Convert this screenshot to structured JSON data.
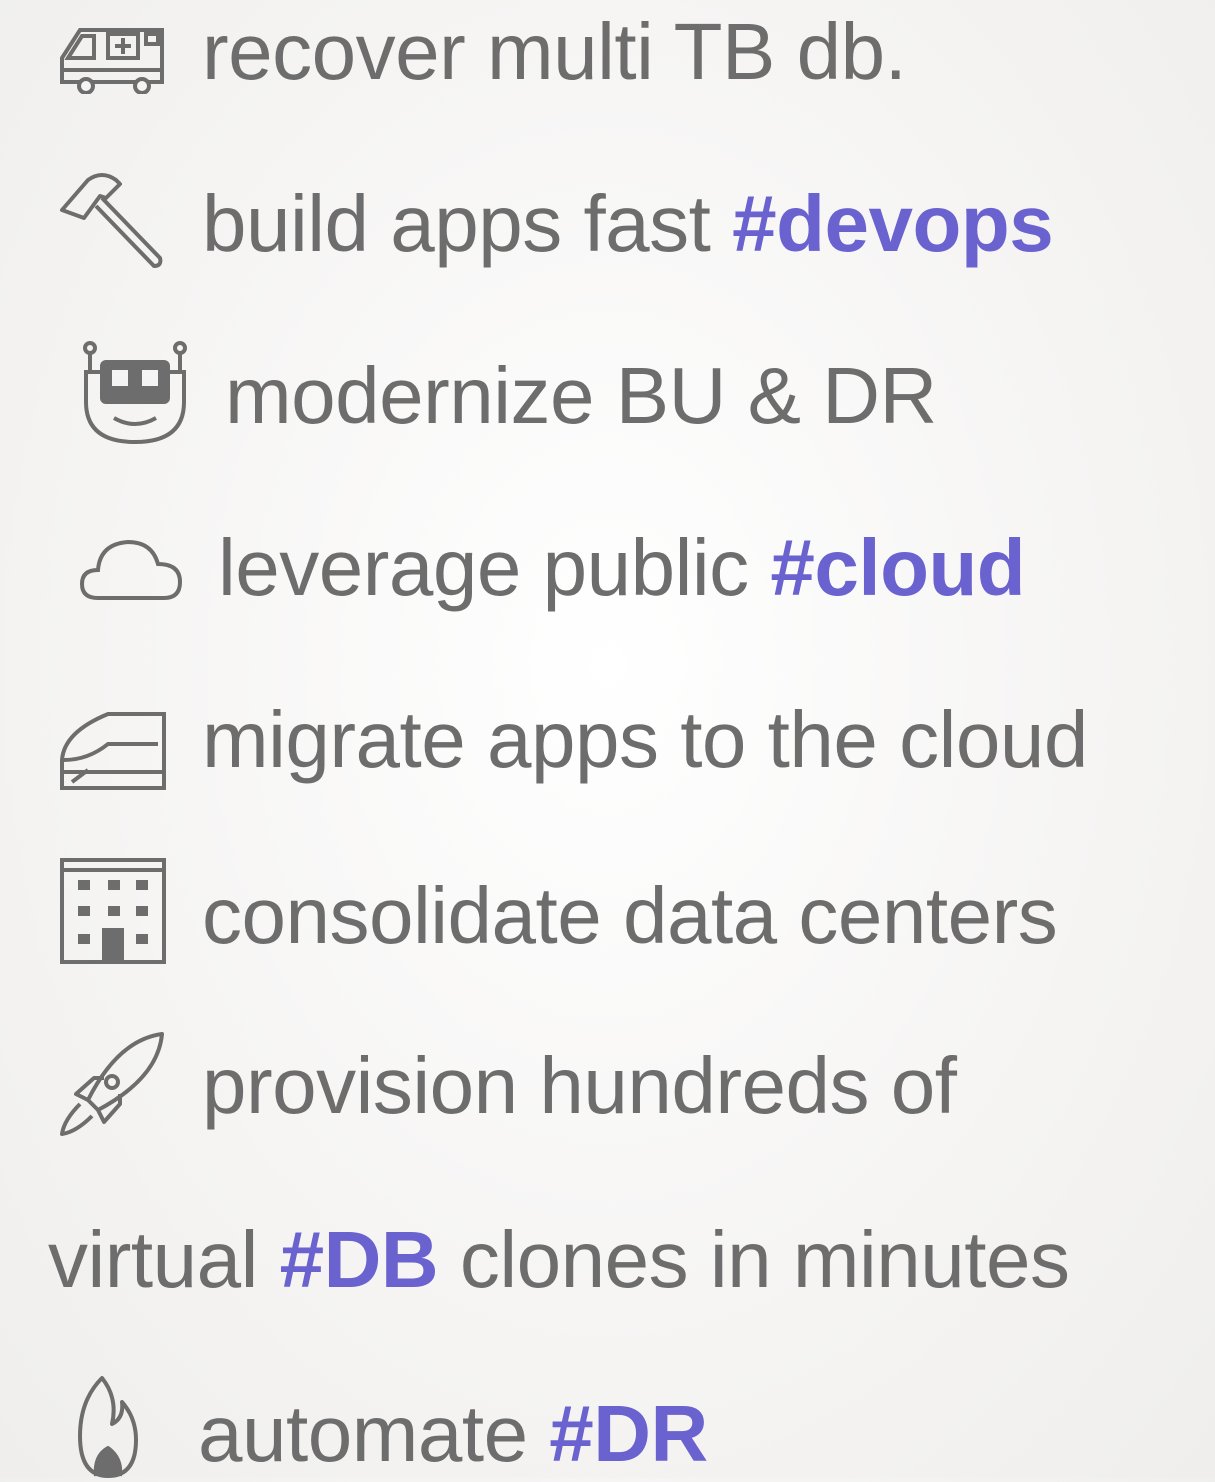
{
  "lines": [
    {
      "icon": "ambulance-icon",
      "text": "recover multi TB db.",
      "tag": ""
    },
    {
      "icon": "hammer-icon",
      "text": "build apps fast ",
      "tag": "#devops"
    },
    {
      "icon": "robot-icon",
      "text": "modernize BU & DR",
      "tag": ""
    },
    {
      "icon": "cloud-icon",
      "text": "leverage public ",
      "tag": "#cloud"
    },
    {
      "icon": "train-icon",
      "text": "migrate apps to the cloud",
      "tag": ""
    },
    {
      "icon": "building-icon",
      "text": "consolidate data centers",
      "tag": ""
    },
    {
      "icon": "rocket-icon",
      "text": "provision hundreds of",
      "tag": ""
    },
    {
      "icon": "",
      "text_before": "virtual ",
      "tag": "#DB",
      "text_after": " clones in minutes"
    },
    {
      "icon": "flame-icon",
      "text": "automate ",
      "tag": "#DR"
    }
  ],
  "colors": {
    "text": "#6d6d6d",
    "tag": "#6a62cf",
    "icon": "#6d6d6d"
  }
}
